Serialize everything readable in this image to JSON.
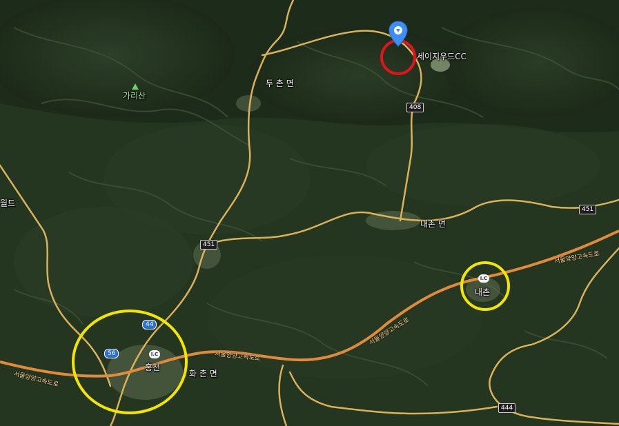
{
  "colors": {
    "terrain": "#24331f",
    "ridge": "#3c5236",
    "road": "#d9b25a",
    "expressway": "#e08a3c",
    "highlight_yellow": "#f2e600",
    "highlight_red": "#e0141c",
    "pin": "#3d8ff5"
  },
  "icons": {
    "pin": "location-pin-icon",
    "peak": "mountain-peak-icon",
    "interchange": "ic-icon"
  },
  "labels": {
    "gari_mountain": "가리산",
    "duchon": "두 촌 면",
    "naechon": "내촌 면",
    "hwachon": "화 촌 면",
    "hongcheon": "홍천",
    "naechon_ic": "내촌",
    "golf": "세이지우드CC",
    "left_edge": "월드"
  },
  "routes": {
    "r408": "408",
    "r451_a": "451",
    "r451_b": "451",
    "r44": "44",
    "r56": "56",
    "r444": "444"
  },
  "interchange_badge": "I.C",
  "expressway": {
    "label_a": "서울양양고속도로",
    "label_b": "서울양양고속도로",
    "label_c": "서울양양고속도로",
    "label_d": "서울양양고속도로"
  }
}
